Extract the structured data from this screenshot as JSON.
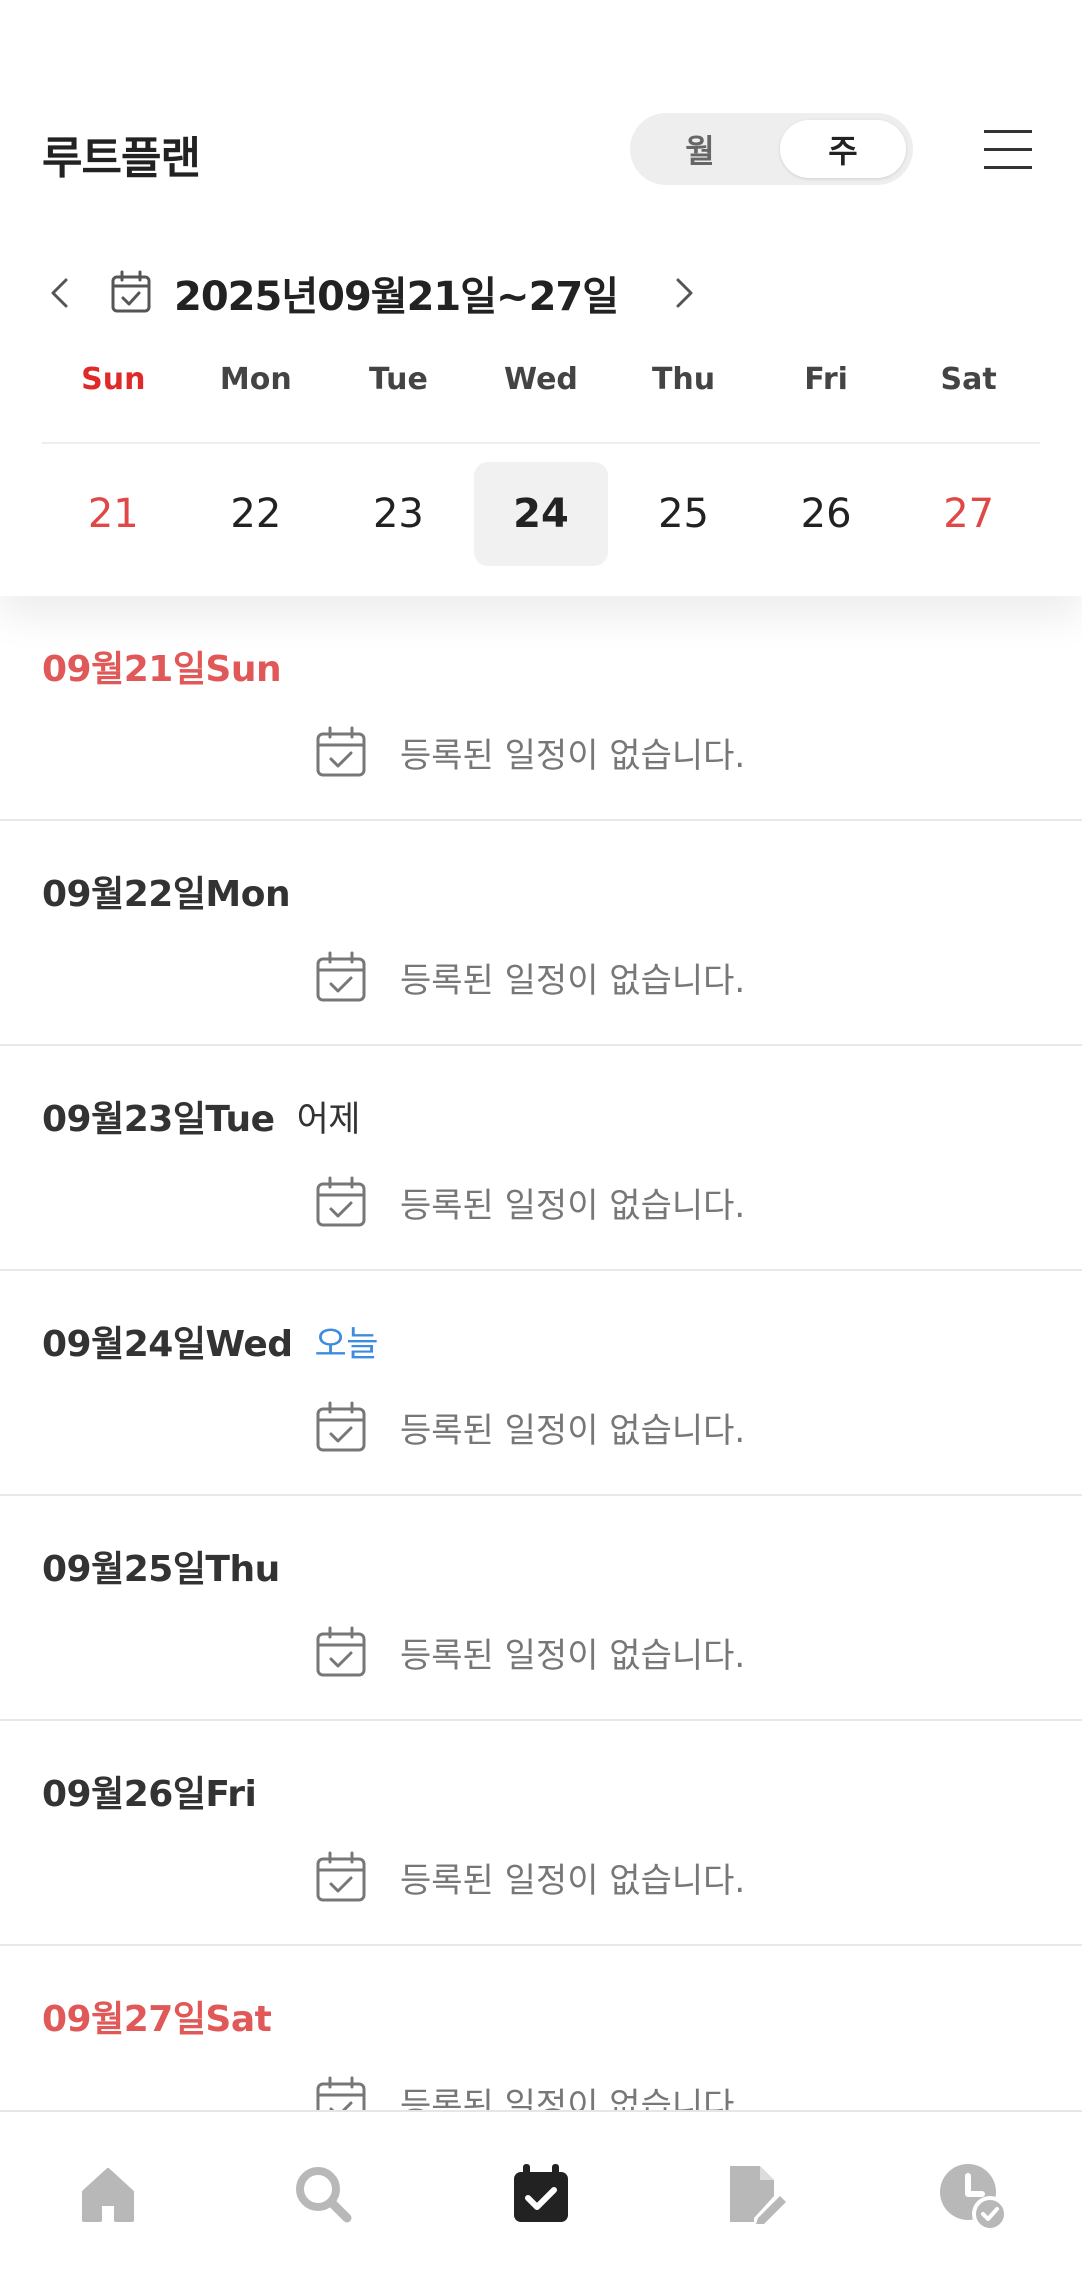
{
  "header": {
    "app_title": "루트플랜",
    "view_toggle": {
      "month_label": "월",
      "week_label": "주",
      "selected": "week"
    }
  },
  "week_nav": {
    "range_text": "2025년09월21일~27일"
  },
  "weekdays": [
    "Sun",
    "Mon",
    "Tue",
    "Wed",
    "Thu",
    "Fri",
    "Sat"
  ],
  "dates": [
    "21",
    "22",
    "23",
    "24",
    "25",
    "26",
    "27"
  ],
  "selected_date": "24",
  "days": [
    {
      "heading": "09월21일Sun",
      "tag": "",
      "empty_text": "등록된 일정이 없습니다."
    },
    {
      "heading": "09월22일Mon",
      "tag": "",
      "empty_text": "등록된 일정이 없습니다."
    },
    {
      "heading": "09월23일Tue",
      "tag": "어제",
      "empty_text": "등록된 일정이 없습니다."
    },
    {
      "heading": "09월24일Wed",
      "tag": "오늘",
      "empty_text": "등록된 일정이 없습니다."
    },
    {
      "heading": "09월25일Thu",
      "tag": "",
      "empty_text": "등록된 일정이 없습니다."
    },
    {
      "heading": "09월26일Fri",
      "tag": "",
      "empty_text": "등록된 일정이 없습니다."
    },
    {
      "heading": "09월27일Sat",
      "tag": "",
      "empty_text": "등록된 일정이 없습니다."
    }
  ],
  "bottom_nav": {
    "items": [
      {
        "icon": "home-icon",
        "active": false
      },
      {
        "icon": "search-icon",
        "active": false
      },
      {
        "icon": "calendar-check-icon",
        "active": true
      },
      {
        "icon": "document-edit-icon",
        "active": false
      },
      {
        "icon": "clock-check-icon",
        "active": false
      }
    ]
  },
  "colors": {
    "weekend_red": "#e04848",
    "today_blue": "#3d8ce0",
    "inactive_icon": "#b8b8b8",
    "active_icon": "#222222"
  }
}
